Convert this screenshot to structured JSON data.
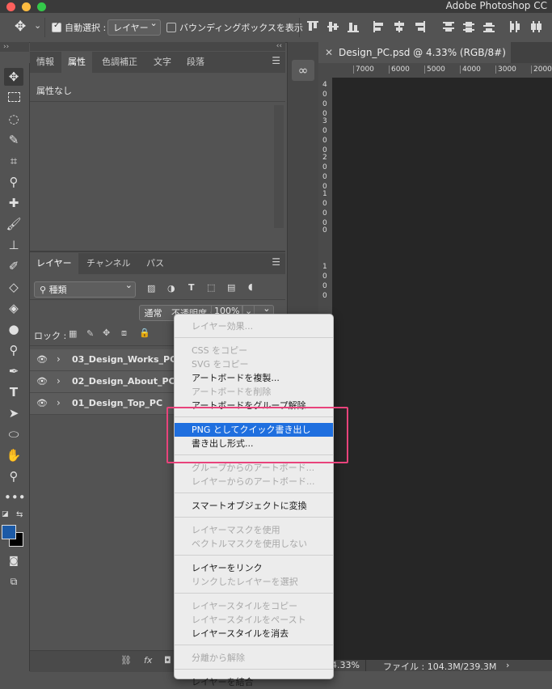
{
  "app": {
    "title": "Adobe Photoshop CC"
  },
  "options_bar": {
    "auto_select_label": "自動選択 :",
    "auto_select_value": "レイヤー",
    "bounding_box_label": "バウンディングボックスを表示"
  },
  "properties_panel": {
    "tabs": [
      "情報",
      "属性",
      "色調補正",
      "文字",
      "段落"
    ],
    "active_tab": "属性",
    "content": "属性なし"
  },
  "layers_panel": {
    "tabs": [
      "レイヤー",
      "チャンネル",
      "パス"
    ],
    "active_tab": "レイヤー",
    "filter_label": "種類",
    "blend_mode": "通常",
    "opacity_label": "不透明度 :",
    "opacity_value": "100%",
    "lock_label": "ロック :",
    "layers": [
      "03_Design_Works_PC",
      "02_Design_About_PC",
      "01_Design_Top_PC"
    ],
    "bottom_icons": [
      "link-icon",
      "fx-icon"
    ],
    "fx_label": "fx"
  },
  "document": {
    "tab_title": "Design_PC.psd @ 4.33% (RGB/8#) *",
    "ruler_labels": [
      "7000",
      "6000",
      "5000",
      "4000",
      "3000",
      "2000"
    ],
    "vertical_ruler_digits": [
      "4",
      "0",
      "0",
      "0",
      "3",
      "0",
      "0",
      "0",
      "2",
      "0",
      "0",
      "0",
      "1",
      "0",
      "0",
      "0",
      "0",
      "1",
      "0",
      "0",
      "0"
    ],
    "zoom": "4.33%",
    "file_info": "ファイル : 104.3M/239.3M"
  },
  "context_menu": {
    "sections": [
      [
        {
          "label": "レイヤー効果...",
          "enabled": false
        }
      ],
      [
        {
          "label": "CSS をコピー",
          "enabled": false
        },
        {
          "label": "SVG をコピー",
          "enabled": false
        },
        {
          "label": "アートボードを複製...",
          "enabled": true
        },
        {
          "label": "アートボードを削除",
          "enabled": false
        },
        {
          "label": "アートボードをグループ解除",
          "enabled": true
        }
      ],
      [
        {
          "label": "PNG としてクイック書き出し",
          "enabled": true,
          "highlighted": true
        },
        {
          "label": "書き出し形式...",
          "enabled": true
        }
      ],
      [
        {
          "label": "グループからのアートボード...",
          "enabled": false
        },
        {
          "label": "レイヤーからのアートボード...",
          "enabled": false
        }
      ],
      [
        {
          "label": "スマートオブジェクトに変換",
          "enabled": true
        }
      ],
      [
        {
          "label": "レイヤーマスクを使用",
          "enabled": false
        },
        {
          "label": "ベクトルマスクを使用しない",
          "enabled": false
        }
      ],
      [
        {
          "label": "レイヤーをリンク",
          "enabled": true
        },
        {
          "label": "リンクしたレイヤーを選択",
          "enabled": false
        }
      ],
      [
        {
          "label": "レイヤースタイルをコピー",
          "enabled": false
        },
        {
          "label": "レイヤースタイルをペースト",
          "enabled": false
        },
        {
          "label": "レイヤースタイルを消去",
          "enabled": true
        }
      ],
      [
        {
          "label": "分離から解除",
          "enabled": false
        }
      ],
      [
        {
          "label": "レイヤーを結合",
          "enabled": true
        }
      ]
    ]
  },
  "colors": {
    "foreground": "#1c5aa6",
    "background": "#000000",
    "highlight": "#1f6fdf",
    "annotation_box": "#e8437b"
  }
}
